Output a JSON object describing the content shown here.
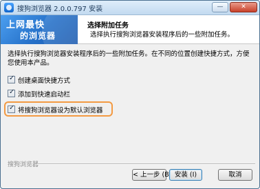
{
  "window": {
    "title": "搜狗浏览器 2.0.0.797 安装",
    "minimize_label": "—",
    "close_label": "✕"
  },
  "header": {
    "logo_line1": "上网最快",
    "logo_line2": "的浏览器",
    "step_title": "选择附加任务",
    "step_description": "选择执行搜狗浏览器安装程序后的一些附加任务。"
  },
  "body": {
    "instructions": "选择执行搜狗浏览器安装程序后的一些附加任务。在不同的位置创建快捷方式，方便您使用本产品。",
    "options": [
      {
        "label": "创建桌面快捷方式",
        "checked": true
      },
      {
        "label": "添加到快速启动栏",
        "checked": true
      },
      {
        "label": "将搜狗浏览器设为默认浏览器",
        "checked": true
      }
    ],
    "highlight_color": "#f39a42"
  },
  "footer": {
    "brand": "搜狗浏览器",
    "back_button": "< 上一步 (B)",
    "install_button": "安装 (I)",
    "cancel_button": "取消"
  }
}
